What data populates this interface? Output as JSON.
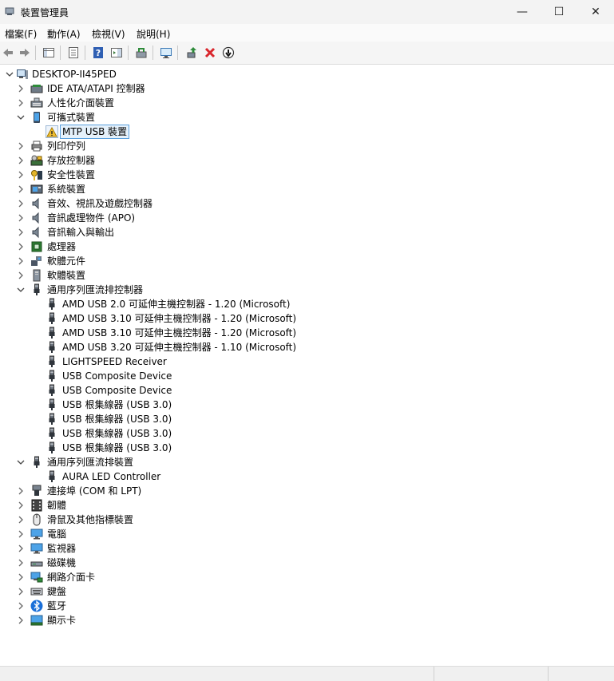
{
  "window": {
    "title": "裝置管理員",
    "minimize_glyph": "—",
    "maximize_glyph": "☐",
    "close_glyph": "✕"
  },
  "menu": [
    {
      "label": "檔案(F)"
    },
    {
      "label": "動作(A)"
    },
    {
      "label": "檢視(V)"
    },
    {
      "label": "說明(H)"
    }
  ],
  "toolbar": [
    {
      "icon": "back-arrow-icon"
    },
    {
      "icon": "forward-arrow-icon"
    },
    {
      "icon": "show-hide-console-tree-icon"
    },
    {
      "icon": "properties-icon"
    },
    {
      "icon": "help-icon"
    },
    {
      "icon": "action-pane-icon"
    },
    {
      "icon": "update-driver-icon"
    },
    {
      "icon": "scan-hardware-icon"
    },
    {
      "icon": "add-legacy-hardware-icon"
    },
    {
      "icon": "uninstall-device-icon"
    },
    {
      "icon": "disable-device-icon"
    }
  ],
  "tree": [
    {
      "label": "DESKTOP-II45PED",
      "level": 0,
      "state": "expanded",
      "icon": "computer-icon"
    },
    {
      "label": "IDE ATA/ATAPI 控制器",
      "level": 1,
      "state": "collapsed",
      "icon": "ide-controller-icon"
    },
    {
      "label": "人性化介面裝置",
      "level": 1,
      "state": "collapsed",
      "icon": "hid-icon"
    },
    {
      "label": "可攜式裝置",
      "level": 1,
      "state": "expanded",
      "icon": "portable-device-icon"
    },
    {
      "label": "MTP USB 裝置",
      "level": 2,
      "state": "leaf",
      "icon": "warning-device-icon",
      "selected": true
    },
    {
      "label": "列印佇列",
      "level": 1,
      "state": "collapsed",
      "icon": "printer-icon"
    },
    {
      "label": "存放控制器",
      "level": 1,
      "state": "collapsed",
      "icon": "storage-controller-icon"
    },
    {
      "label": "安全性裝置",
      "level": 1,
      "state": "collapsed",
      "icon": "security-device-icon"
    },
    {
      "label": "系統裝置",
      "level": 1,
      "state": "collapsed",
      "icon": "system-device-icon"
    },
    {
      "label": "音效、視訊及遊戲控制器",
      "level": 1,
      "state": "collapsed",
      "icon": "speaker-icon"
    },
    {
      "label": "音訊處理物件 (APO)",
      "level": 1,
      "state": "collapsed",
      "icon": "speaker-icon"
    },
    {
      "label": "音訊輸入與輸出",
      "level": 1,
      "state": "collapsed",
      "icon": "speaker-icon"
    },
    {
      "label": "處理器",
      "level": 1,
      "state": "collapsed",
      "icon": "processor-icon"
    },
    {
      "label": "軟體元件",
      "level": 1,
      "state": "collapsed",
      "icon": "software-component-icon"
    },
    {
      "label": "軟體裝置",
      "level": 1,
      "state": "collapsed",
      "icon": "software-device-icon"
    },
    {
      "label": "通用序列匯流排控制器",
      "level": 1,
      "state": "expanded",
      "icon": "usb-icon"
    },
    {
      "label": "AMD USB 2.0 可延伸主機控制器 - 1.20 (Microsoft)",
      "level": 2,
      "state": "leaf",
      "icon": "usb-icon"
    },
    {
      "label": "AMD USB 3.10 可延伸主機控制器 - 1.20 (Microsoft)",
      "level": 2,
      "state": "leaf",
      "icon": "usb-icon"
    },
    {
      "label": "AMD USB 3.10 可延伸主機控制器 - 1.20 (Microsoft)",
      "level": 2,
      "state": "leaf",
      "icon": "usb-icon"
    },
    {
      "label": "AMD USB 3.20 可延伸主機控制器 - 1.10 (Microsoft)",
      "level": 2,
      "state": "leaf",
      "icon": "usb-icon"
    },
    {
      "label": "LIGHTSPEED Receiver",
      "level": 2,
      "state": "leaf",
      "icon": "usb-icon"
    },
    {
      "label": "USB Composite Device",
      "level": 2,
      "state": "leaf",
      "icon": "usb-icon"
    },
    {
      "label": "USB Composite Device",
      "level": 2,
      "state": "leaf",
      "icon": "usb-icon"
    },
    {
      "label": "USB 根集線器 (USB 3.0)",
      "level": 2,
      "state": "leaf",
      "icon": "usb-icon"
    },
    {
      "label": "USB 根集線器 (USB 3.0)",
      "level": 2,
      "state": "leaf",
      "icon": "usb-icon"
    },
    {
      "label": "USB 根集線器 (USB 3.0)",
      "level": 2,
      "state": "leaf",
      "icon": "usb-icon"
    },
    {
      "label": "USB 根集線器 (USB 3.0)",
      "level": 2,
      "state": "leaf",
      "icon": "usb-icon"
    },
    {
      "label": "通用序列匯流排裝置",
      "level": 1,
      "state": "expanded",
      "icon": "usb-icon"
    },
    {
      "label": "AURA LED Controller",
      "level": 2,
      "state": "leaf",
      "icon": "usb-icon"
    },
    {
      "label": "連接埠 (COM 和 LPT)",
      "level": 1,
      "state": "collapsed",
      "icon": "port-icon"
    },
    {
      "label": "韌體",
      "level": 1,
      "state": "collapsed",
      "icon": "firmware-icon"
    },
    {
      "label": "滑鼠及其他指標裝置",
      "level": 1,
      "state": "collapsed",
      "icon": "mouse-icon"
    },
    {
      "label": "電腦",
      "level": 1,
      "state": "collapsed",
      "icon": "monitor-icon"
    },
    {
      "label": "監視器",
      "level": 1,
      "state": "collapsed",
      "icon": "monitor-icon"
    },
    {
      "label": "磁碟機",
      "level": 1,
      "state": "collapsed",
      "icon": "disk-drive-icon"
    },
    {
      "label": "網路介面卡",
      "level": 1,
      "state": "collapsed",
      "icon": "network-adapter-icon"
    },
    {
      "label": "鍵盤",
      "level": 1,
      "state": "collapsed",
      "icon": "keyboard-icon"
    },
    {
      "label": "藍牙",
      "level": 1,
      "state": "collapsed",
      "icon": "bluetooth-icon"
    },
    {
      "label": "顯示卡",
      "level": 1,
      "state": "collapsed",
      "icon": "display-adapter-icon"
    }
  ],
  "colors": {
    "selection_border": "#5aa0de",
    "selection_fill": "#e5f1fb",
    "uninstall_red": "#d9262c",
    "help_blue": "#2f5fb3",
    "bluetooth_blue": "#1a6fd8"
  }
}
